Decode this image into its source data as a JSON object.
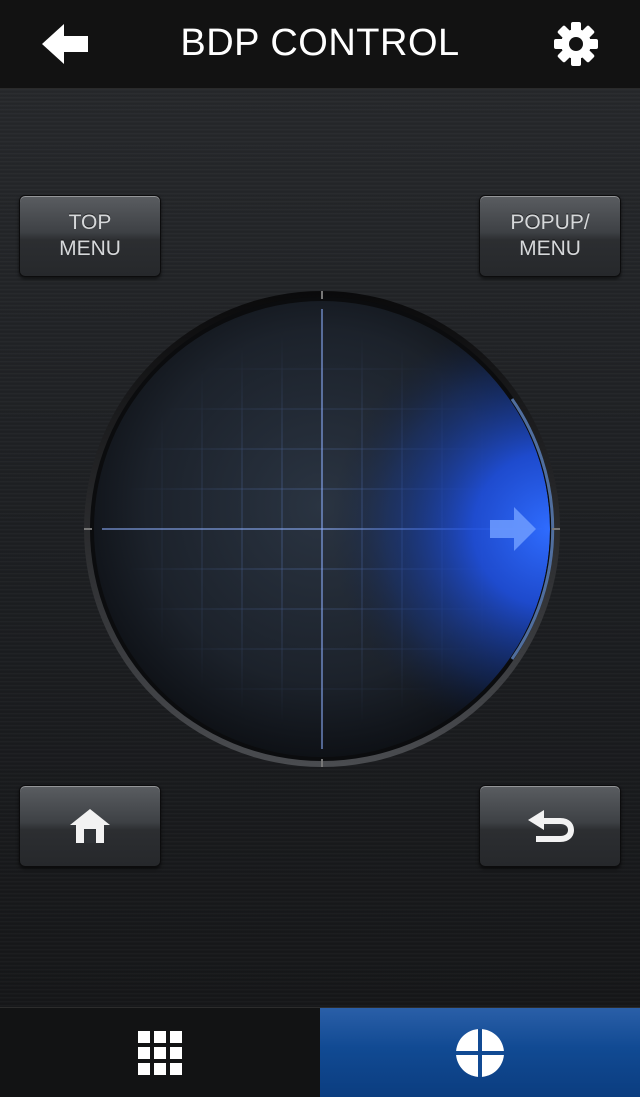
{
  "header": {
    "title": "BDP CONTROL",
    "back_icon": "arrow-left-icon",
    "settings_icon": "gear-icon"
  },
  "buttons": {
    "top_menu": {
      "line1": "TOP",
      "line2": "MENU"
    },
    "popup_menu": {
      "line1": "POPUP/",
      "line2": "MENU"
    },
    "home_icon": "home-icon",
    "return_icon": "return-icon"
  },
  "touchpad": {
    "direction_icon": "arrow-right-icon",
    "active_direction": "right",
    "accent_color": "#1e5bff"
  },
  "tabs": [
    {
      "name": "keypad",
      "icon": "grid-icon",
      "selected": false
    },
    {
      "name": "touchpad",
      "icon": "crosshair-icon",
      "selected": true
    }
  ],
  "colors": {
    "tab_selected": "#114a93",
    "header_bg": "#121212"
  }
}
